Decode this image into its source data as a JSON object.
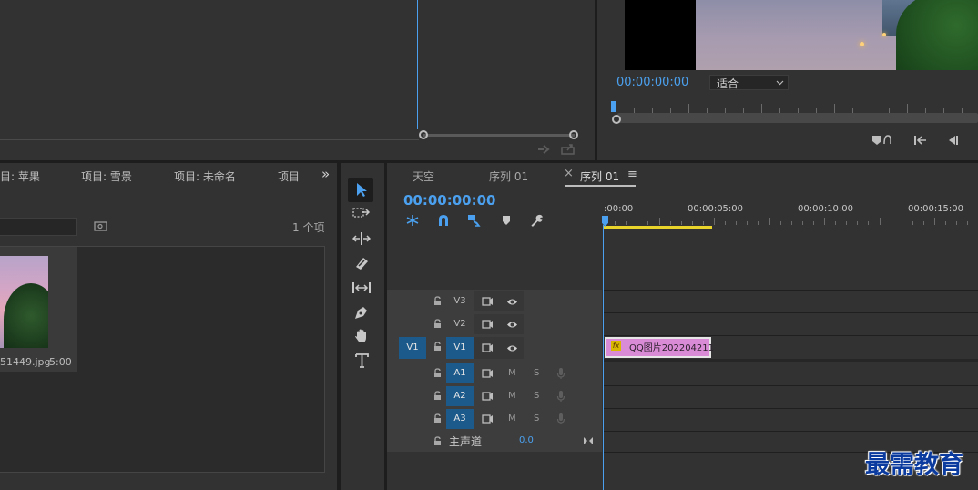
{
  "program": {
    "timecode": "00:00:00:00",
    "fit_label": "适合"
  },
  "project": {
    "tabs": [
      {
        "label": "目: 苹果"
      },
      {
        "label": "项目: 雪景"
      },
      {
        "label": "项目: 未命名"
      },
      {
        "label": "项目"
      }
    ],
    "more_glyph": "»",
    "item_count": "1 个项",
    "clip": {
      "name": "51449.jpg",
      "duration": "5:00"
    }
  },
  "timeline": {
    "tabs": [
      {
        "label": "天空"
      },
      {
        "label": "序列 01"
      },
      {
        "label": "序列 01",
        "active": true
      }
    ],
    "close_glyph": "×",
    "menu_glyph": "≡",
    "timecode": "00:00:00:00",
    "ruler_labels": [
      ":00:00",
      "00:00:05:00",
      "00:00:10:00",
      "00:00:15:00"
    ],
    "video_tracks": [
      "V3",
      "V2",
      "V1"
    ],
    "audio_tracks": [
      "A1",
      "A2",
      "A3"
    ],
    "source_patch": "V1",
    "mute_label": "M",
    "solo_label": "S",
    "master": {
      "label": "主声道",
      "value": "0.0"
    },
    "clip": {
      "fx": "fx",
      "name": "QQ图片202204211"
    }
  },
  "watermark": "最需教育",
  "colors": {
    "accent_blue": "#4ba1ef",
    "track_on": "#1c5a8c",
    "clip_pink": "#d98bd6",
    "work_area_yellow": "#e8d42a"
  }
}
